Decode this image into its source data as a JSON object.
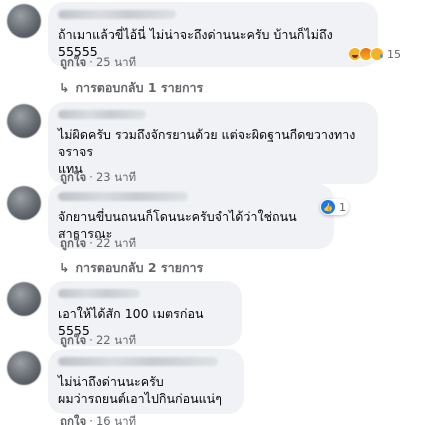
{
  "comments": [
    {
      "text": "ถ้าเมาแล้วขี่ไอ้นี่ ไม่น่าจะถึงด่านนะครับ บ้านก็ไม่ถึง 55555",
      "like_label": "ถูกใจ",
      "time": "25 นาที",
      "reaction_count": "15",
      "reactions": [
        "haha-icon",
        "angry-icon",
        "sad-icon"
      ],
      "reply_label": "การตอบกลับ 1 รายการ"
    },
    {
      "text": "ไม่ผิดครับ รวมถึงจักรยานด้วย แต่จะผิดฐานกีดขวางทางจราจร\nแทน",
      "like_label": "ถูกใจ",
      "time": "23 นาที"
    },
    {
      "text": "จักยานขี่บนถนนก็โดนนะครับจำได้ว่าใช่ถนนสาธารณะ",
      "like_label": "ถูกใจ",
      "time": "22 นาที",
      "reaction_count": "1",
      "reply_label": "การตอบกลับ 2 รายการ"
    },
    {
      "text": "เอาให้ได้สัก 100 เมตรก่อน 5555",
      "like_label": "ถูกใจ",
      "time": "22 นาที"
    },
    {
      "text": "ไม่น่าถึงด่านนะครับ\nผมว่ารถยนต์เอาไปกินก่อนแน่ๆ",
      "like_label": "ถูกใจ",
      "time": "16 นาที"
    }
  ],
  "colors": {
    "bubble": "#f0f2f5",
    "meta_text": "#65676b",
    "like_blue": "#1877f2"
  }
}
